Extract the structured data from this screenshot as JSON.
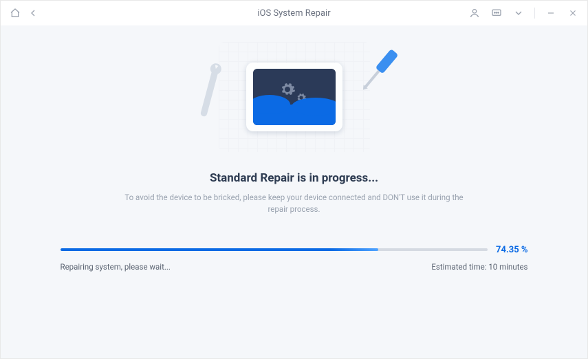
{
  "titlebar": {
    "title": "iOS System Repair"
  },
  "main": {
    "heading": "Standard Repair is in progress...",
    "subtext": "To avoid the device to be bricked, please keep your device connected and DON'T use it during the repair process."
  },
  "progress": {
    "percent_label": "74.35 %",
    "percent_value": 74.35,
    "status": "Repairing system, please wait...",
    "estimated_label": "Estimated time: 10 minutes"
  },
  "colors": {
    "accent": "#0b6ae4"
  }
}
